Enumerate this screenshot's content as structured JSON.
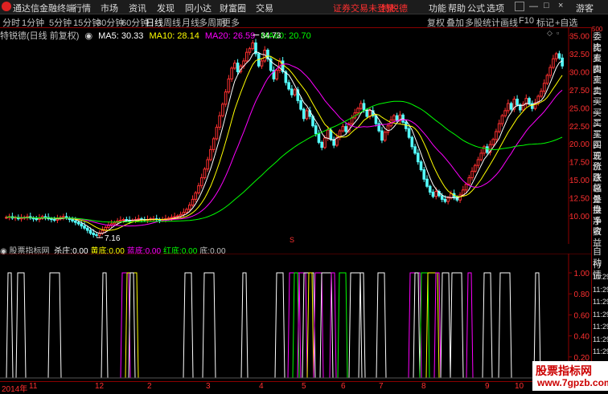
{
  "app": {
    "title": "通达信金融终端"
  },
  "menu": [
    "行情",
    "市场",
    "资讯",
    "发现",
    "同小达",
    "财富圈",
    "交易"
  ],
  "notice": "证券交易未登录",
  "stock_name": "特锐德",
  "top_right": [
    "功能",
    "帮助",
    "公式",
    "选项",
    "游客"
  ],
  "periods": [
    "分时",
    "1分钟",
    "5分钟",
    "15分钟",
    "30分钟",
    "60分钟",
    "日线",
    "周线",
    "月线",
    "多周期",
    "更多"
  ],
  "active_period": "日线",
  "tools": [
    "复权",
    "叠加",
    "多股",
    "统计",
    "画线",
    "F10",
    "标记",
    "+自选"
  ],
  "ma_line": {
    "name": "特锐德(日线 前复权)",
    "ma5": "MA5: 30.33",
    "ma10": "MA10: 28.14",
    "ma20": "MA20: 26.59",
    "ma60": "MA60: 20.70"
  },
  "colors": {
    "ma5": "#ffffff",
    "ma10": "#ffff00",
    "ma20": "#ff00ff",
    "ma60": "#00ff00",
    "up": "#ff3030",
    "down": "#54ffff",
    "axis": "#ff3030"
  },
  "price_axis": [
    "35.00",
    "32.50",
    "30.00",
    "27.50",
    "25.00",
    "22.50",
    "20.00",
    "17.50",
    "15.00",
    "12.50",
    "10.00"
  ],
  "annotations": {
    "high": "34.73",
    "low": "7.16",
    "event_mark": "S"
  },
  "sidepanel": [
    "委比",
    "卖五",
    "卖四",
    "卖三",
    "卖二",
    "卖一",
    "买一",
    "买二",
    "买三",
    "买四",
    "买五",
    "现价",
    "涨跌",
    "涨幅",
    "总量",
    "外盘",
    "换手",
    "净资",
    "收益"
  ],
  "sidepanel_lower": [
    "自动",
    "行情",
    "11:29",
    "11:29",
    "11:29",
    "11:29",
    "11:29",
    "11:29",
    "11:29"
  ],
  "sidepanel_top_value": "500",
  "sub_indicator": {
    "name": "股票指标网",
    "items": [
      {
        "label": "杀庄:",
        "value": "0.00",
        "color": "#ffffff"
      },
      {
        "label": "黄底:",
        "value": "0.00",
        "color": "#ffff00"
      },
      {
        "label": "蓝底:",
        "value": "0.00",
        "color": "#ff00ff"
      },
      {
        "label": "红底:",
        "value": "0.00",
        "color": "#00ff00"
      },
      {
        "label": "底:",
        "value": "0.00",
        "color": "#c0c0c0"
      }
    ]
  },
  "sub_axis": [
    "1.00",
    "0.80",
    "0.60",
    "0.40",
    "0.20"
  ],
  "dates": [
    "2014年",
    "11",
    "12",
    "2",
    "3",
    "4",
    "5",
    "6",
    "7",
    "8",
    "9",
    "10"
  ],
  "watermark": {
    "line1": "股票指标网",
    "line2": "www.7gpzb.com"
  },
  "chart_data": {
    "type": "candlestick",
    "title": "",
    "ylabel": "",
    "ylim": [
      7.0,
      35.5
    ],
    "ma_periods": [
      5,
      10,
      20,
      60
    ],
    "close_series": [
      9.8,
      9.9,
      9.7,
      9.8,
      9.6,
      9.7,
      9.8,
      9.9,
      9.7,
      9.6,
      9.5,
      9.7,
      9.9,
      9.8,
      9.6,
      9.5,
      9.4,
      9.6,
      9.8,
      9.9,
      9.7,
      9.5,
      9.3,
      9.1,
      8.9,
      8.6,
      8.3,
      8.0,
      7.6,
      7.4,
      7.3,
      7.6,
      8.0,
      8.4,
      8.7,
      8.9,
      9.1,
      9.3,
      9.4,
      9.5,
      9.4,
      9.3,
      9.4,
      9.5,
      9.6,
      9.5,
      9.4,
      9.5,
      9.6,
      9.6,
      9.5,
      9.4,
      9.5,
      9.6,
      9.7,
      9.8,
      9.9,
      10.0,
      10.2,
      10.5,
      10.9,
      11.5,
      12.3,
      13.2,
      14.2,
      15.3,
      16.5,
      17.8,
      19.2,
      20.7,
      22.3,
      23.9,
      25.5,
      27.2,
      29.0,
      30.5,
      31.2,
      30.0,
      30.8,
      31.5,
      32.7,
      33.2,
      34.0,
      32.5,
      30.8,
      31.5,
      33.0,
      31.8,
      30.2,
      29.0,
      30.2,
      31.5,
      30.0,
      28.5,
      27.6,
      26.8,
      27.5,
      26.0,
      24.8,
      23.5,
      24.6,
      23.8,
      22.5,
      21.4,
      20.2,
      19.5,
      20.8,
      21.9,
      20.6,
      19.8,
      20.9,
      21.8,
      22.4,
      21.7,
      22.8,
      23.6,
      24.3,
      24.9,
      25.6,
      24.7,
      23.8,
      24.6,
      23.9,
      22.8,
      21.8,
      20.5,
      21.6,
      22.5,
      23.3,
      23.9,
      23.2,
      24.0,
      23.0,
      22.1,
      20.9,
      19.6,
      18.7,
      17.5,
      16.4,
      15.1,
      14.1,
      13.3,
      12.7,
      13.4,
      12.8,
      12.3,
      12.0,
      12.5,
      13.1,
      12.6,
      12.2,
      12.9,
      13.6,
      14.4,
      15.3,
      16.2,
      17.0,
      17.8,
      18.7,
      19.6,
      18.8,
      19.9,
      20.6,
      21.7,
      22.8,
      23.9,
      24.6,
      25.6,
      24.8,
      26.2,
      25.4,
      24.7,
      25.5,
      26.3,
      25.6,
      24.9,
      25.7,
      26.6,
      27.3,
      28.4,
      29.5,
      30.6,
      31.8,
      32.5,
      31.9,
      30.8
    ]
  }
}
